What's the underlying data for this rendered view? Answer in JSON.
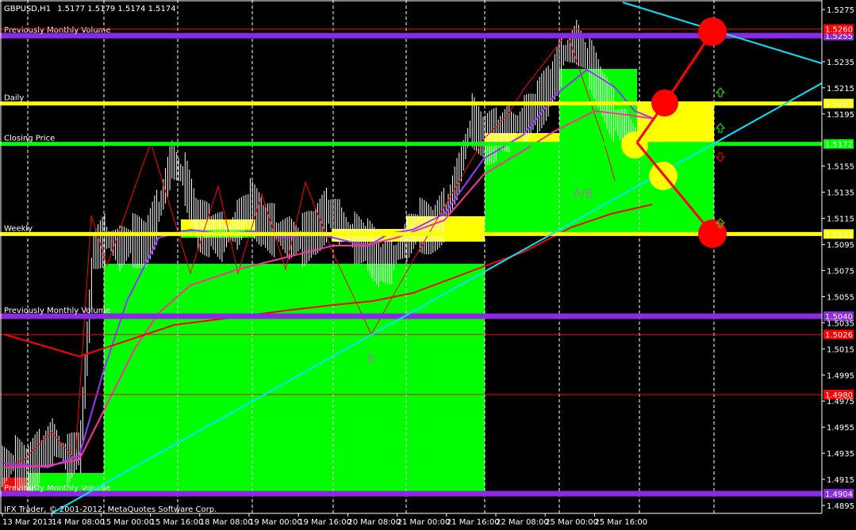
{
  "header": {
    "symbol": "GBPUSD,H1",
    "ohlc": "1.5177 1.5179 1.5174 1.5174"
  },
  "copyright": "IFX Trader, © 2001-2012, MetaQuotes Software Corp.",
  "colors": {
    "background": "#000000",
    "green_zone": "#00ff00",
    "yellow_zone": "#ffff00",
    "red": "#ff0000",
    "purple": "#8a2be2",
    "cyan": "#00e5ff",
    "magenta": "#ff1493"
  },
  "price_axis": {
    "ticks": [
      "1.5275",
      "1.5235",
      "1.5215",
      "1.5195",
      "1.5155",
      "1.5135",
      "1.5115",
      "1.5095",
      "1.5075",
      "1.5055",
      "1.5035",
      "1.5015",
      "1.4995",
      "1.4975",
      "1.4955",
      "1.4935",
      "1.4915",
      "1.4895"
    ],
    "max": 1.5275,
    "min": 1.4895
  },
  "time_axis": [
    "13 Mar 2013",
    "14 Mar 08:00",
    "15 Mar 00:00",
    "15 Mar 16:00",
    "18 Mar 08:00",
    "19 Mar 00:00",
    "19 Mar 16:00",
    "20 Mar 08:00",
    "21 Mar 00:00",
    "21 Mar 16:00",
    "22 Mar 08:00",
    "25 Mar 00:00",
    "25 Mar 16:00"
  ],
  "levels": [
    {
      "name": "Previously Monthly Volume",
      "price": 1.5255,
      "label": "1.5255",
      "color": "#8a2be2",
      "kind": "purple"
    },
    {
      "name": "",
      "price": 1.526,
      "label": "1.5260",
      "color": "#ff0000",
      "kind": "red"
    },
    {
      "name": "Daily",
      "price": 1.5203,
      "label": "1.5203",
      "color": "#ffff00",
      "kind": "yellow"
    },
    {
      "name": "Closing Price",
      "price": 1.5172,
      "label": "1.5172",
      "color": "#00ff00",
      "kind": "green"
    },
    {
      "name": "Weekly",
      "price": 1.5103,
      "label": "1.5103",
      "color": "#ffff00",
      "kind": "yellow"
    },
    {
      "name": "Previously Monthly Volume",
      "price": 1.504,
      "label": "1.5040",
      "color": "#8a2be2",
      "kind": "purple"
    },
    {
      "name": "",
      "price": 1.5026,
      "label": "1.5026",
      "color": "#ff0000",
      "kind": "red"
    },
    {
      "name": "",
      "price": 1.498,
      "label": "1.4980",
      "color": "#ff0000",
      "kind": "red"
    },
    {
      "name": "Previously Monthly Volume",
      "price": 1.4904,
      "label": "1.4904",
      "color": "#8a2be2",
      "kind": "purple"
    }
  ],
  "annotations": {
    "ab": "A/B",
    "b": "B"
  },
  "price_path": [
    1.4925,
    1.4928,
    1.4922,
    1.4935,
    1.4945,
    1.493,
    1.494,
    1.509,
    1.51,
    1.5092,
    1.5098,
    1.5095,
    1.512,
    1.516,
    1.5145,
    1.511,
    1.5105,
    1.51,
    1.511,
    1.5125,
    1.511,
    1.5105,
    1.51,
    1.5098,
    1.5105,
    1.512,
    1.511,
    1.51,
    1.5095,
    1.508,
    1.5085,
    1.51,
    1.511,
    1.5105,
    1.512,
    1.515,
    1.519,
    1.5175,
    1.518,
    1.5185,
    1.519,
    1.52,
    1.5215,
    1.524,
    1.525,
    1.5235,
    1.521,
    1.519,
    1.518,
    1.5174
  ]
}
